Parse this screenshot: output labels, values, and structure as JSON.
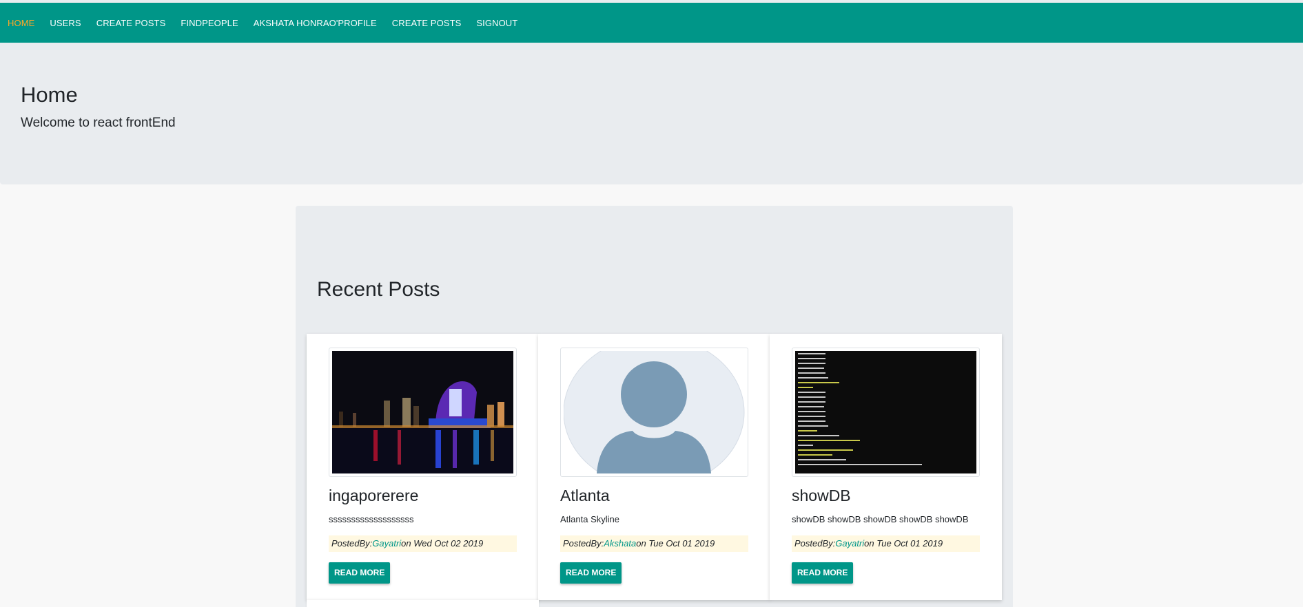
{
  "nav": {
    "items": [
      {
        "label": "HOME",
        "active": true
      },
      {
        "label": "USERS"
      },
      {
        "label": "CREATE POSTS"
      },
      {
        "label": "FINDPEOPLE"
      },
      {
        "label": "AKSHATA HONRAO'PROFILE"
      },
      {
        "label": "CREATE POSTS"
      },
      {
        "label": "SIGNOUT"
      }
    ]
  },
  "hero": {
    "title": "Home",
    "subtitle": "Welcome to react frontEnd"
  },
  "recent": {
    "heading": "Recent Posts"
  },
  "posts": [
    {
      "title": "ingaporerere",
      "body": "sssssssssssssssssss",
      "posted_by_label": "PostedBy:",
      "author": "Gayatri",
      "date_text": "on Wed Oct 02 2019",
      "button": "READ MORE",
      "image": "night-city-skyline"
    },
    {
      "title": "Atlanta",
      "body": "Atlanta Skyline",
      "posted_by_label": "PostedBy:",
      "author": "Akshata",
      "date_text": "on Tue Oct 01 2019",
      "button": "READ MORE",
      "image": "default-avatar"
    },
    {
      "title": "showDB",
      "body": "showDB showDB showDB showDB showDB",
      "posted_by_label": "PostedBy:",
      "author": "Gayatri",
      "date_text": "on Tue Oct 01 2019",
      "button": "READ MORE",
      "image": "terminal-screenshot"
    }
  ],
  "colors": {
    "primary": "#009688",
    "active_nav": "#ffa726",
    "meta_bg": "#fff8e1",
    "panel_bg": "#e9ecef"
  }
}
